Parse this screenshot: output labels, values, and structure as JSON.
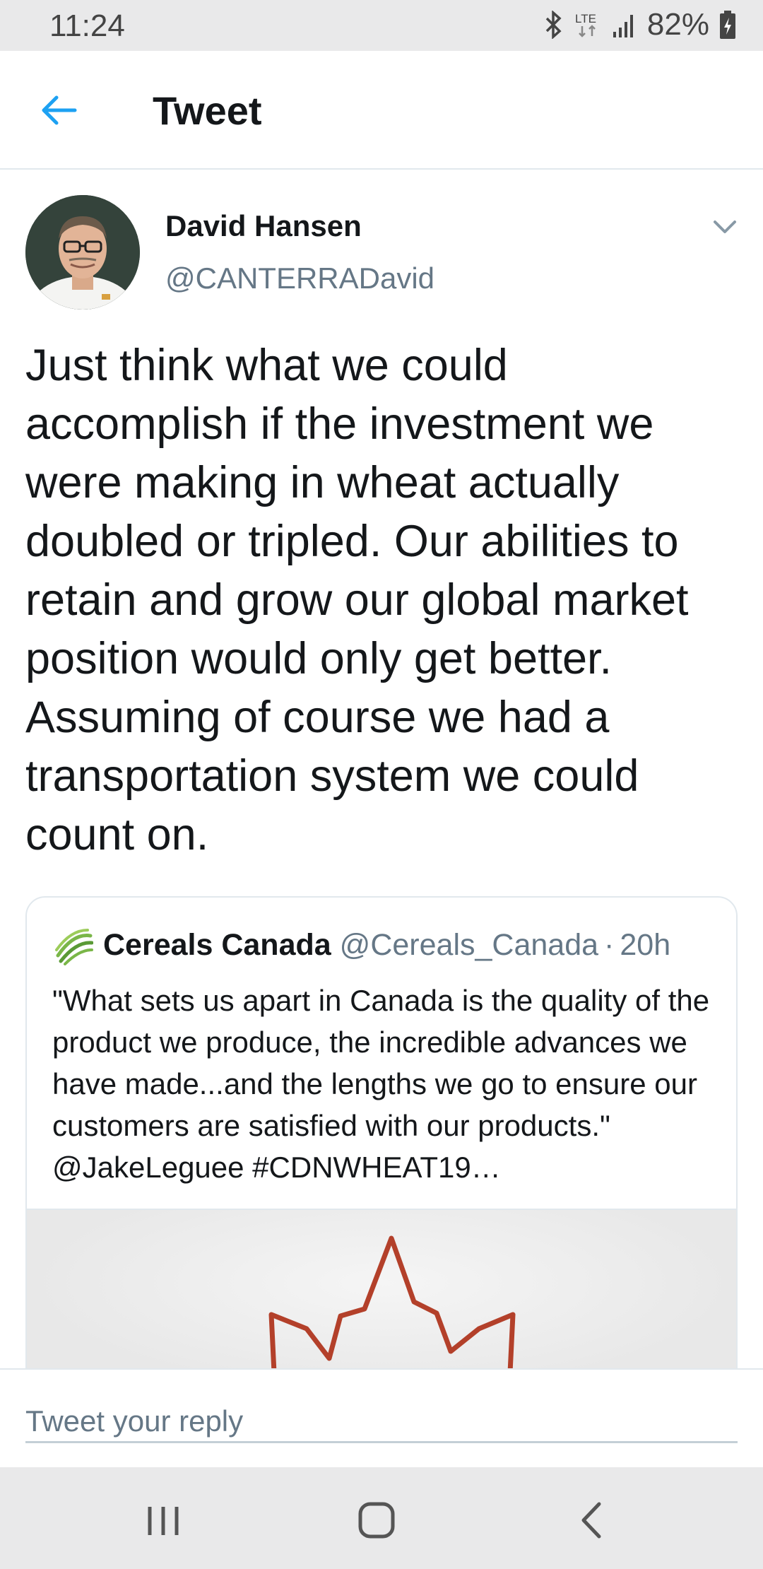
{
  "status_bar": {
    "time": "11:24",
    "network": "LTE",
    "battery": "82%"
  },
  "header": {
    "title": "Tweet",
    "accent_color": "#1da1f2"
  },
  "tweet": {
    "author_name": "David Hansen",
    "author_handle": "@CANTERRADavid",
    "text": "Just think what we could accomplish if the investment we were making in wheat actually doubled or tripled. Our abilities to retain and grow our global market position would only get better. Assuming of course we had a transportation system we could count on."
  },
  "quoted_tweet": {
    "author_name": "Cereals Canada",
    "author_handle": "@Cereals_Canada",
    "separator": "·",
    "time": "20h",
    "text": "\"What sets us apart in Canada is the quality of the product we produce, the incredible advances we have made...and the lengths we go to ensure our customers are satisfied with our products.\" @JakeLeguee #CDNWHEAT19…",
    "logo_color": "#7ab648",
    "media_accent_color": "#b3402a"
  },
  "reply": {
    "placeholder": "Tweet your reply"
  },
  "nav": {
    "recents_icon": "recents-icon",
    "home_icon": "home-icon",
    "back_icon": "back-icon"
  }
}
